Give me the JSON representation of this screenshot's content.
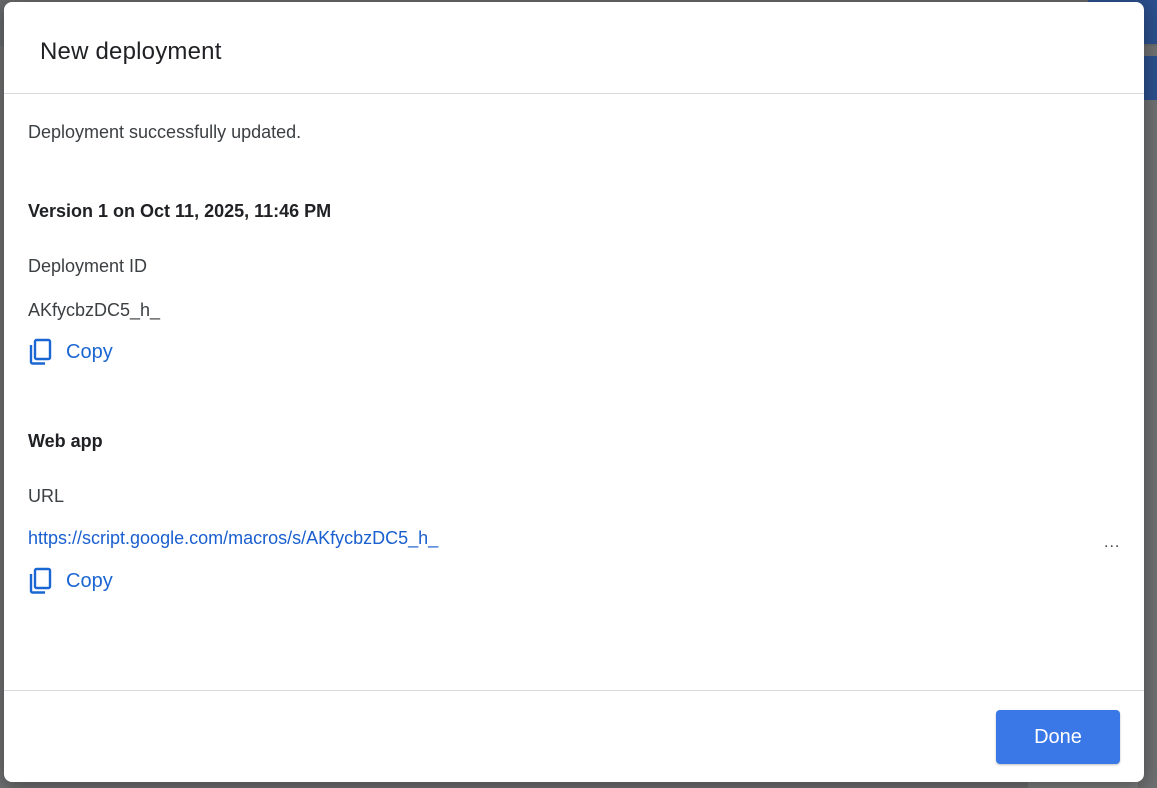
{
  "dialog": {
    "title": "New deployment",
    "status_message": "Deployment successfully updated.",
    "version_heading": "Version 1 on Oct 11, 2025, 11:46 PM",
    "deployment_id": {
      "label": "Deployment ID",
      "value": "AKfycbzDC5_h_",
      "copy_label": "Copy"
    },
    "web_app": {
      "heading": "Web app",
      "url_label": "URL",
      "url_value": "https://script.google.com/macros/s/AKfycbzDC5_h_",
      "truncation": "...",
      "copy_label": "Copy"
    },
    "done_label": "Done"
  },
  "colors": {
    "primary_button": "#3b78e7",
    "link": "#1a73e8"
  },
  "icons": {
    "copy": "copy-icon"
  }
}
